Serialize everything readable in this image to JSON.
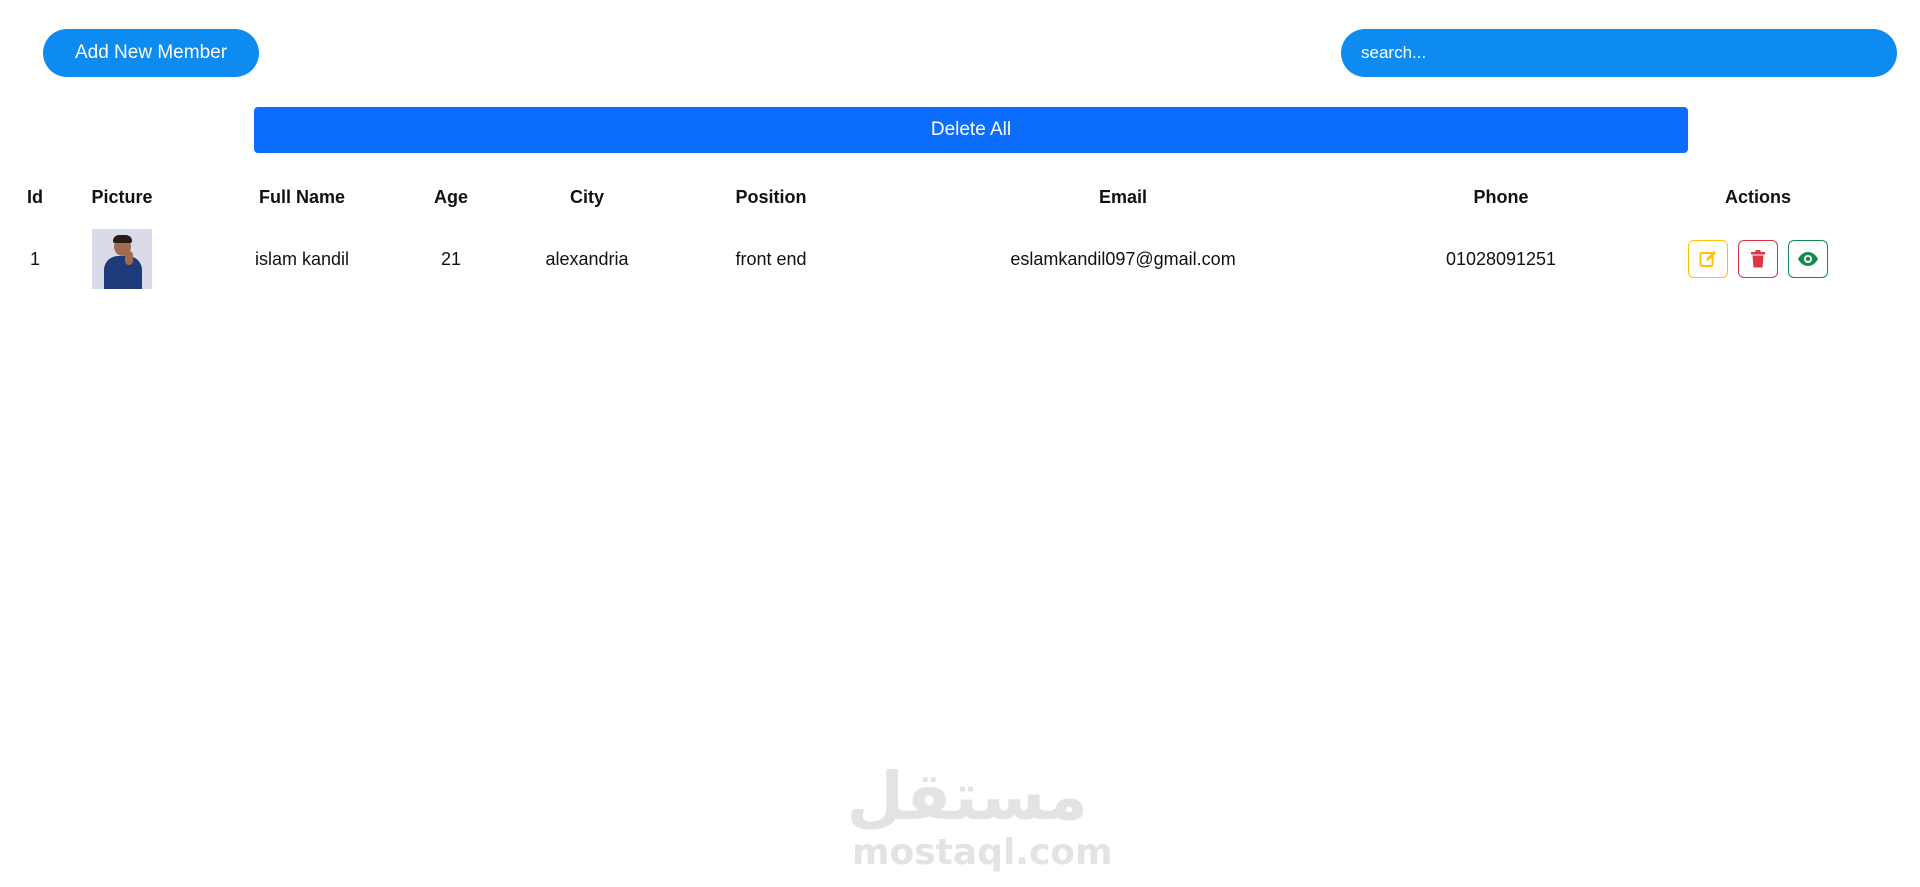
{
  "toolbar": {
    "add_label": "Add New Member",
    "search_placeholder": "search...",
    "delete_all_label": "Delete All"
  },
  "table": {
    "headers": [
      "Id",
      "Picture",
      "Full Name",
      "Age",
      "City",
      "Position",
      "Email",
      "Phone",
      "Actions"
    ],
    "rows": [
      {
        "id": "1",
        "picture": "member-photo",
        "full_name": "islam kandil",
        "age": "21",
        "city": "alexandria",
        "position": "front end",
        "email": "eslamkandil097@gmail.com",
        "phone": "01028091251",
        "actions": [
          "edit-icon",
          "trash-icon",
          "eye-icon"
        ]
      }
    ]
  },
  "watermark": {
    "arabic": "مستقل",
    "latin": "mostaql.com"
  },
  "colors": {
    "primary": "#0d8bf0",
    "delete_all": "#0d6efd",
    "edit": "#ffc107",
    "delete": "#dc3545",
    "view": "#198754",
    "watermark": "#e3e3e3"
  }
}
